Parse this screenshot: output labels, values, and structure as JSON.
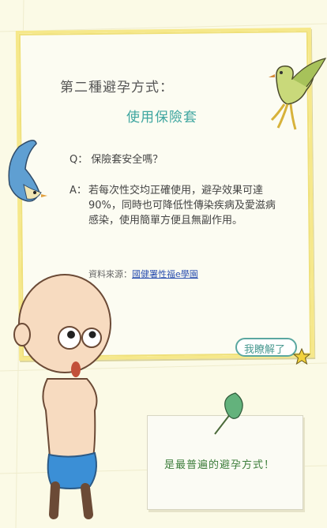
{
  "title": "第二種避孕方式：",
  "subtitle": "使用保險套",
  "question": {
    "label": "Q：",
    "text": "保險套安全嗎？"
  },
  "answer": {
    "label": "A：",
    "text": "若每次性交均正確使用，避孕效果可達90%，同時也可降低性傳染疾病及愛滋病感染，使用簡單方便且無副作用。"
  },
  "source": {
    "label": "資料來源：",
    "link": "國健署性福e學園"
  },
  "understand_button": "我瞭解了",
  "note": "是最普遍的避孕方式！",
  "colors": {
    "accent_teal": "#3fa6a0",
    "card_border": "#f6e88a",
    "note_green": "#3c7d3a",
    "link_blue": "#2a4fb0"
  }
}
